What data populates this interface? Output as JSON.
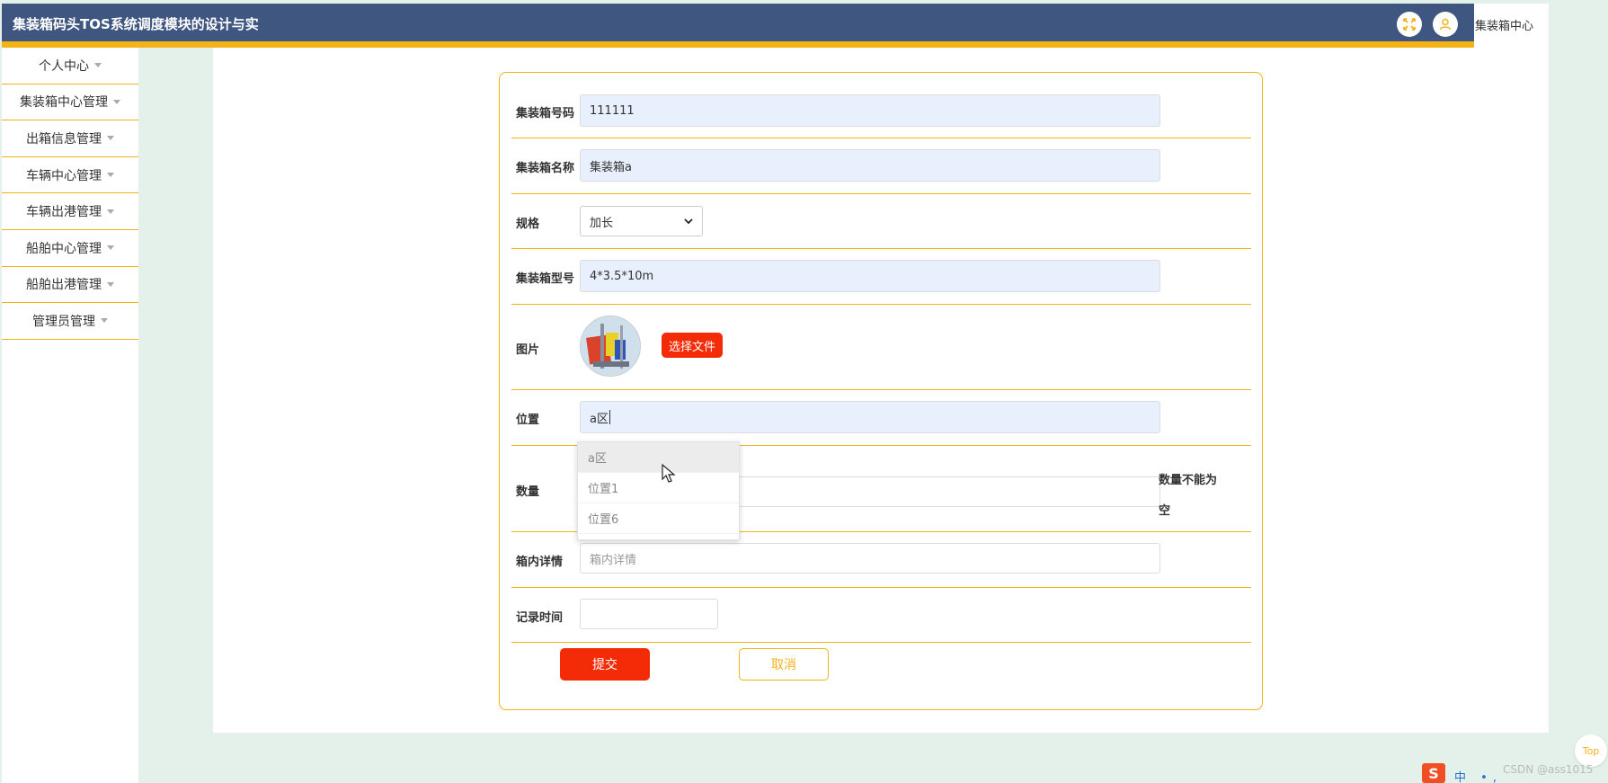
{
  "header": {
    "title": "集装箱码头TOS系统调度模块的设计与实",
    "right_text": "集装箱中心"
  },
  "sidebar": {
    "items": [
      {
        "label": "个人中心"
      },
      {
        "label": "集装箱中心管理"
      },
      {
        "label": "出箱信息管理"
      },
      {
        "label": "车辆中心管理"
      },
      {
        "label": "车辆出港管理"
      },
      {
        "label": "船舶中心管理"
      },
      {
        "label": "船舶出港管理"
      },
      {
        "label": "管理员管理"
      }
    ]
  },
  "form": {
    "container_no": {
      "label": "集装箱号码",
      "value": "111111"
    },
    "container_name": {
      "label": "集装箱名称",
      "value": "集装箱a"
    },
    "spec": {
      "label": "规格",
      "value": "加长"
    },
    "model": {
      "label": "集装箱型号",
      "value": "4*3.5*10m"
    },
    "image": {
      "label": "图片",
      "button": "选择文件"
    },
    "location": {
      "label": "位置",
      "value": "a区"
    },
    "quantity": {
      "label": "数量",
      "value": "",
      "error": "数量不能为空"
    },
    "details": {
      "label": "箱内详情",
      "placeholder": "箱内详情"
    },
    "record_time": {
      "label": "记录时间",
      "value": ""
    },
    "submit_label": "提交",
    "cancel_label": "取消"
  },
  "location_dropdown": {
    "options": [
      "a区",
      "位置1",
      "位置6"
    ],
    "highlighted": "a区"
  },
  "footer": {
    "top_label": "Top",
    "watermark": "CSDN @ass1015",
    "ime_char": "中"
  },
  "colors": {
    "header_bg": "#3f5680",
    "accent": "#f5b217",
    "primary_button": "#f42b07",
    "page_bg": "#e4f0ea"
  }
}
